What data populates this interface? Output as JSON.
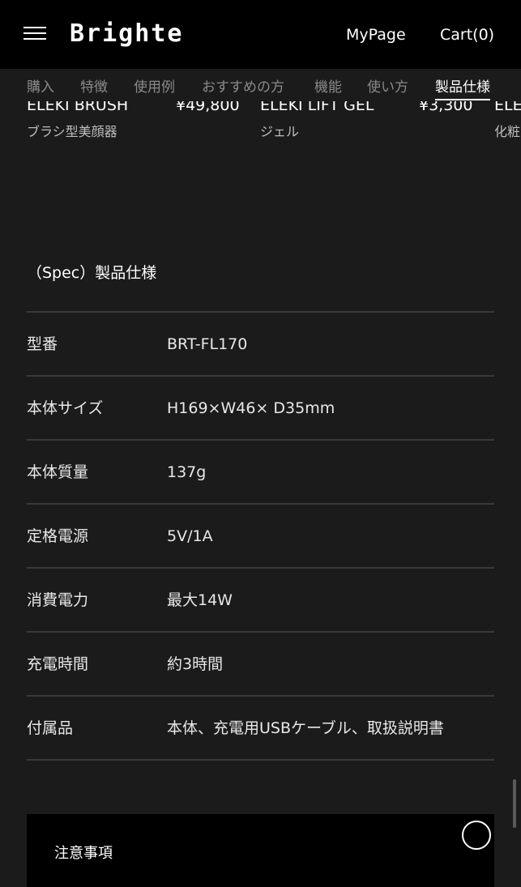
{
  "header": {
    "logo": "Brighte",
    "mypage": "MyPage",
    "cart": "Cart(0)",
    "menu_icon": "hamburger-menu-icon"
  },
  "tabs": [
    {
      "label": "購入"
    },
    {
      "label": "特徴"
    },
    {
      "label": "使用例"
    },
    {
      "label": "おすすめの方"
    },
    {
      "label": "機能"
    },
    {
      "label": "使い方"
    },
    {
      "label": "製品仕様",
      "active": true
    }
  ],
  "products": [
    {
      "name": "ELEKI BRUSH",
      "price": "¥49,800",
      "sub": "ブラシ型美顔器"
    },
    {
      "name": "ELEKI LIFT GEL",
      "price": "¥3,300",
      "sub": "ジェル"
    },
    {
      "name": "ELE",
      "sub": "化粧"
    }
  ],
  "spec": {
    "title": "（Spec）製品仕様",
    "rows": [
      {
        "label": "型番",
        "value": "BRT-FL170"
      },
      {
        "label": "本体サイズ",
        "value": "H169×W46× D35mm"
      },
      {
        "label": "本体質量",
        "value": "137g"
      },
      {
        "label": "定格電源",
        "value": "5V/1A"
      },
      {
        "label": "消費電力",
        "value": "最大14W"
      },
      {
        "label": "充電時間",
        "value": "約3時間"
      },
      {
        "label": "付属品",
        "value": "本体、充電用USBケーブル、取扱説明書"
      }
    ]
  },
  "notice": {
    "title": "注意事項"
  }
}
